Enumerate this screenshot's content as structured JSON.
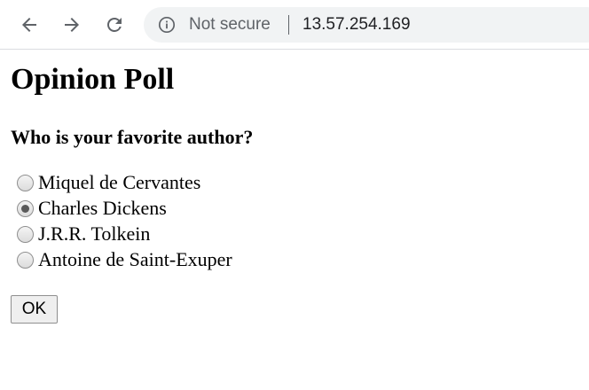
{
  "browser": {
    "security_label": "Not secure",
    "url": "13.57.254.169",
    "icons": {
      "back": "arrow-left-icon",
      "forward": "arrow-right-icon",
      "reload": "reload-icon",
      "info": "info-circle-icon"
    },
    "icon_color": "#5f6368"
  },
  "page": {
    "title": "Opinion Poll",
    "question": "Who is your favorite author?",
    "options": [
      {
        "label": "Miquel de Cervantes",
        "checked": false
      },
      {
        "label": "Charles Dickens",
        "checked": true
      },
      {
        "label": "J.R.R. Tolkein",
        "checked": false
      },
      {
        "label": "Antoine de Saint-Exuper",
        "checked": false
      }
    ],
    "submit_label": "OK"
  }
}
